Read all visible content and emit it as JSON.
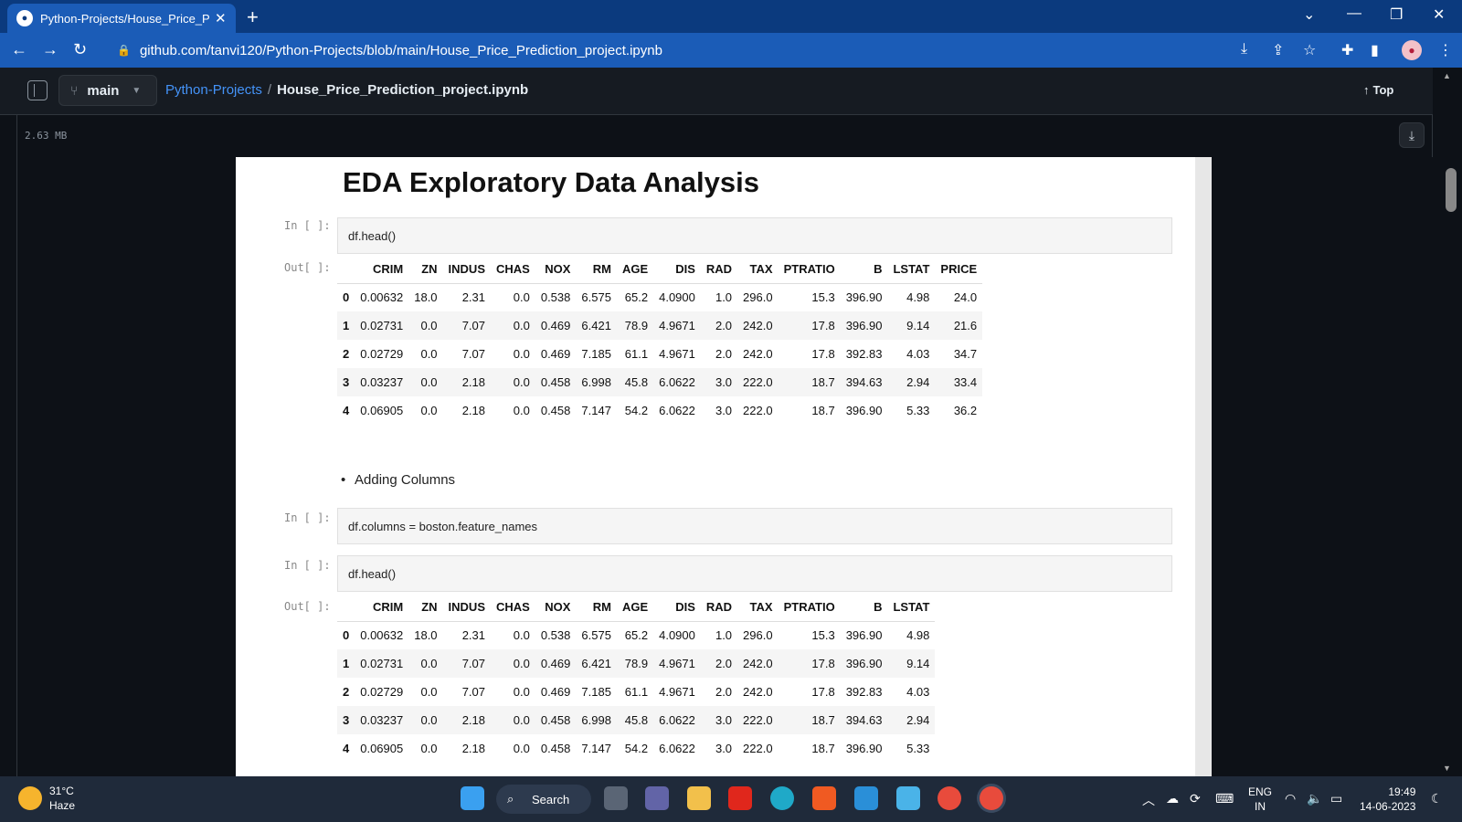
{
  "browser": {
    "tab_title": "Python-Projects/House_Price_Pre",
    "url": "github.com/tanvi120/Python-Projects/blob/main/House_Price_Prediction_project.ipynb"
  },
  "github": {
    "branch": "main",
    "repo": "Python-Projects",
    "separator": "/",
    "file": "House_Price_Prediction_project.ipynb",
    "top_label": "Top",
    "file_size": "2.63 MB"
  },
  "notebook": {
    "heading": "EDA Exploratory Data Analysis",
    "in_prompt": "In [ ]:",
    "out_prompt": "Out[ ]:",
    "cell1_code": "df.head()",
    "bullet": "Adding Columns",
    "cell2_code": "df.columns = boston.feature_names",
    "cell3_code": "df.head()",
    "table1": {
      "headers": [
        "",
        "CRIM",
        "ZN",
        "INDUS",
        "CHAS",
        "NOX",
        "RM",
        "AGE",
        "DIS",
        "RAD",
        "TAX",
        "PTRATIO",
        "B",
        "LSTAT",
        "PRICE"
      ],
      "rows": [
        [
          "0",
          "0.00632",
          "18.0",
          "2.31",
          "0.0",
          "0.538",
          "6.575",
          "65.2",
          "4.0900",
          "1.0",
          "296.0",
          "15.3",
          "396.90",
          "4.98",
          "24.0"
        ],
        [
          "1",
          "0.02731",
          "0.0",
          "7.07",
          "0.0",
          "0.469",
          "6.421",
          "78.9",
          "4.9671",
          "2.0",
          "242.0",
          "17.8",
          "396.90",
          "9.14",
          "21.6"
        ],
        [
          "2",
          "0.02729",
          "0.0",
          "7.07",
          "0.0",
          "0.469",
          "7.185",
          "61.1",
          "4.9671",
          "2.0",
          "242.0",
          "17.8",
          "392.83",
          "4.03",
          "34.7"
        ],
        [
          "3",
          "0.03237",
          "0.0",
          "2.18",
          "0.0",
          "0.458",
          "6.998",
          "45.8",
          "6.0622",
          "3.0",
          "222.0",
          "18.7",
          "394.63",
          "2.94",
          "33.4"
        ],
        [
          "4",
          "0.06905",
          "0.0",
          "2.18",
          "0.0",
          "0.458",
          "7.147",
          "54.2",
          "6.0622",
          "3.0",
          "222.0",
          "18.7",
          "396.90",
          "5.33",
          "36.2"
        ]
      ]
    },
    "table2": {
      "headers": [
        "",
        "CRIM",
        "ZN",
        "INDUS",
        "CHAS",
        "NOX",
        "RM",
        "AGE",
        "DIS",
        "RAD",
        "TAX",
        "PTRATIO",
        "B",
        "LSTAT"
      ],
      "rows": [
        [
          "0",
          "0.00632",
          "18.0",
          "2.31",
          "0.0",
          "0.538",
          "6.575",
          "65.2",
          "4.0900",
          "1.0",
          "296.0",
          "15.3",
          "396.90",
          "4.98"
        ],
        [
          "1",
          "0.02731",
          "0.0",
          "7.07",
          "0.0",
          "0.469",
          "6.421",
          "78.9",
          "4.9671",
          "2.0",
          "242.0",
          "17.8",
          "396.90",
          "9.14"
        ],
        [
          "2",
          "0.02729",
          "0.0",
          "7.07",
          "0.0",
          "0.469",
          "7.185",
          "61.1",
          "4.9671",
          "2.0",
          "242.0",
          "17.8",
          "392.83",
          "4.03"
        ],
        [
          "3",
          "0.03237",
          "0.0",
          "2.18",
          "0.0",
          "0.458",
          "6.998",
          "45.8",
          "6.0622",
          "3.0",
          "222.0",
          "18.7",
          "394.63",
          "2.94"
        ],
        [
          "4",
          "0.06905",
          "0.0",
          "2.18",
          "0.0",
          "0.458",
          "7.147",
          "54.2",
          "6.0622",
          "3.0",
          "222.0",
          "18.7",
          "396.90",
          "5.33"
        ]
      ]
    }
  },
  "taskbar": {
    "temperature": "31°C",
    "condition": "Haze",
    "search_label": "Search",
    "lang_line1": "ENG",
    "lang_line2": "IN",
    "time": "19:49",
    "date": "14-06-2023"
  },
  "colors": {
    "browser_tab": "#0b3a7e",
    "browser_toolbar": "#1b5cb7",
    "github_bg": "#0d1117",
    "link_blue": "#4493f8"
  }
}
